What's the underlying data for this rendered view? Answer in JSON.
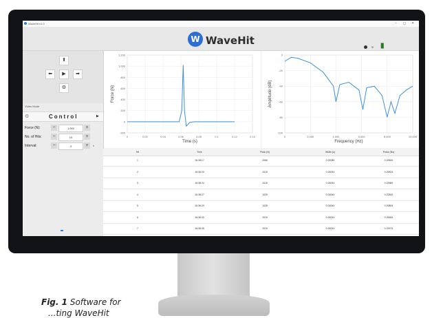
{
  "window": {
    "title": "WaveHit v1.0"
  },
  "header": {
    "brand": "WaveHit",
    "logo_letter": "W"
  },
  "sidebar": {
    "view_mode_label": "Video Mode",
    "control_title": "Control",
    "rows": [
      {
        "label": "Force (N):",
        "value": "1,000",
        "unit": ""
      },
      {
        "label": "No. of Hits:",
        "value": "10",
        "unit": ""
      },
      {
        "label": "Interval:",
        "value": "3",
        "unit": "s"
      }
    ]
  },
  "force_chart": {
    "ylabel": "Force (N)",
    "xlabel": "Time (s)",
    "yticks": [
      "1,200",
      "1,000",
      "800",
      "600",
      "400",
      "200",
      "0",
      "-200"
    ],
    "xticks": [
      "0",
      "0.02",
      "0.04",
      "0.06",
      "0.08",
      "0.1",
      "0.12",
      "0.14"
    ]
  },
  "amp_chart": {
    "ylabel": "Amplitude (dB)",
    "xlabel": "Frequency (Hz)",
    "yticks": [
      "0",
      "-20",
      "-40",
      "-60",
      "-80",
      "-100"
    ],
    "xticks": [
      "0",
      "2,000",
      "4,000",
      "6,000",
      "8,000",
      "10,000"
    ]
  },
  "chart_data": [
    {
      "type": "line",
      "title": "",
      "xlabel": "Time (s)",
      "ylabel": "Force (N)",
      "xlim": [
        0,
        0.14
      ],
      "ylim": [
        -200,
        1200
      ],
      "series": [
        {
          "x": [
            0,
            0.058,
            0.061,
            0.0625,
            0.064,
            0.066,
            0.07,
            0.075,
            0.09,
            0.12
          ],
          "values": [
            0,
            0,
            200,
            1020,
            200,
            -80,
            -10,
            0,
            0,
            0
          ]
        }
      ]
    },
    {
      "type": "line",
      "title": "",
      "xlabel": "Frequency (Hz)",
      "ylabel": "Amplitude (dB)",
      "xlim": [
        0,
        10000
      ],
      "ylim": [
        -100,
        0
      ],
      "series": [
        {
          "x": [
            0,
            500,
            1000,
            2000,
            3000,
            3800,
            4000,
            4300,
            5000,
            5800,
            6100,
            6400,
            7000,
            7600,
            8000,
            8300,
            8600,
            9000,
            9500,
            10000
          ],
          "values": [
            -8,
            -3,
            -4,
            -10,
            -22,
            -40,
            -60,
            -38,
            -35,
            -45,
            -70,
            -42,
            -40,
            -52,
            -80,
            -60,
            -75,
            -52,
            -45,
            -40
          ]
        }
      ]
    }
  ],
  "table": {
    "headers": [
      "Hit",
      "Time",
      "Peak (N)",
      "Width (s)",
      "Pulse (Ns)"
    ],
    "rows": [
      [
        "1",
        "16:38:17",
        "2066",
        "0.00085",
        "0.29849"
      ],
      [
        "2",
        "16:38:20",
        "1015",
        "0.00044",
        "0.29824"
      ],
      [
        "3",
        "16:38:24",
        "1016",
        "0.00044",
        "0.22689"
      ],
      [
        "4",
        "16:38:27",
        "1025",
        "0.00044",
        "0.22849"
      ],
      [
        "5",
        "16:38:29",
        "1028",
        "0.00044",
        "0.29894"
      ],
      [
        "6",
        "16:38:33",
        "1015",
        "0.00044",
        "0.25484"
      ],
      [
        "7",
        "16:38:35",
        "1015",
        "0.00044",
        "0.22974"
      ]
    ]
  },
  "caption": {
    "fig": "Fig. 1",
    "text": "Software for",
    "text2": "...ting WaveHit"
  }
}
